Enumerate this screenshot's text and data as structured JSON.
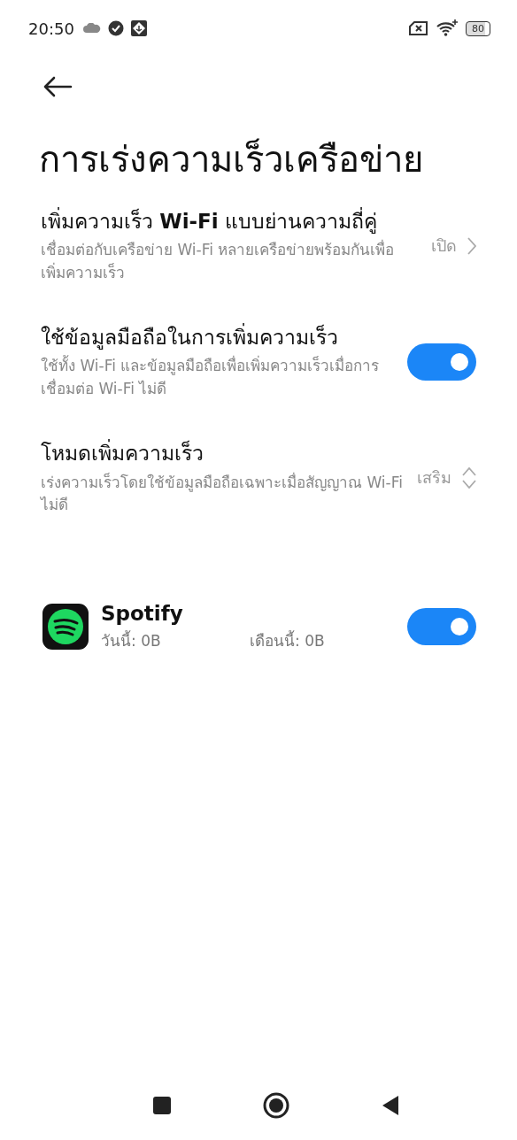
{
  "status_bar": {
    "time": "20:50",
    "battery": "80"
  },
  "title": "การเร่งความเร็วเครือข่าย",
  "settings": [
    {
      "kind": "link",
      "title": "เพิ่มความเร็ว **Wi-Fi** แบบย่านความถี่คู่",
      "description": "เชื่อมต่อกับเครือข่าย Wi-Fi หลายเครือข่ายพร้อมกันเพื่อเพิ่มความเร็ว",
      "value": "เปิด"
    },
    {
      "kind": "toggle",
      "title": "ใช้ข้อมูลมือถือในการเพิ่มความเร็ว",
      "description": "ใช้ทั้ง Wi-Fi และข้อมูลมือถือเพื่อเพิ่มความเร็วเมื่อการเชื่อมต่อ Wi-Fi ไม่ดี",
      "on": true
    },
    {
      "kind": "select",
      "title": "โหมดเพิ่มความเร็ว",
      "description": "เร่งความเร็วโดยใช้ข้อมูลมือถือเฉพาะเมื่อสัญญาณ Wi-Fi ไม่ดี",
      "value": "เสริม"
    }
  ],
  "apps": [
    {
      "name": "Spotify",
      "today": "วันนี้: 0B",
      "month": "เดือนนี้: 0B",
      "on": true
    }
  ]
}
